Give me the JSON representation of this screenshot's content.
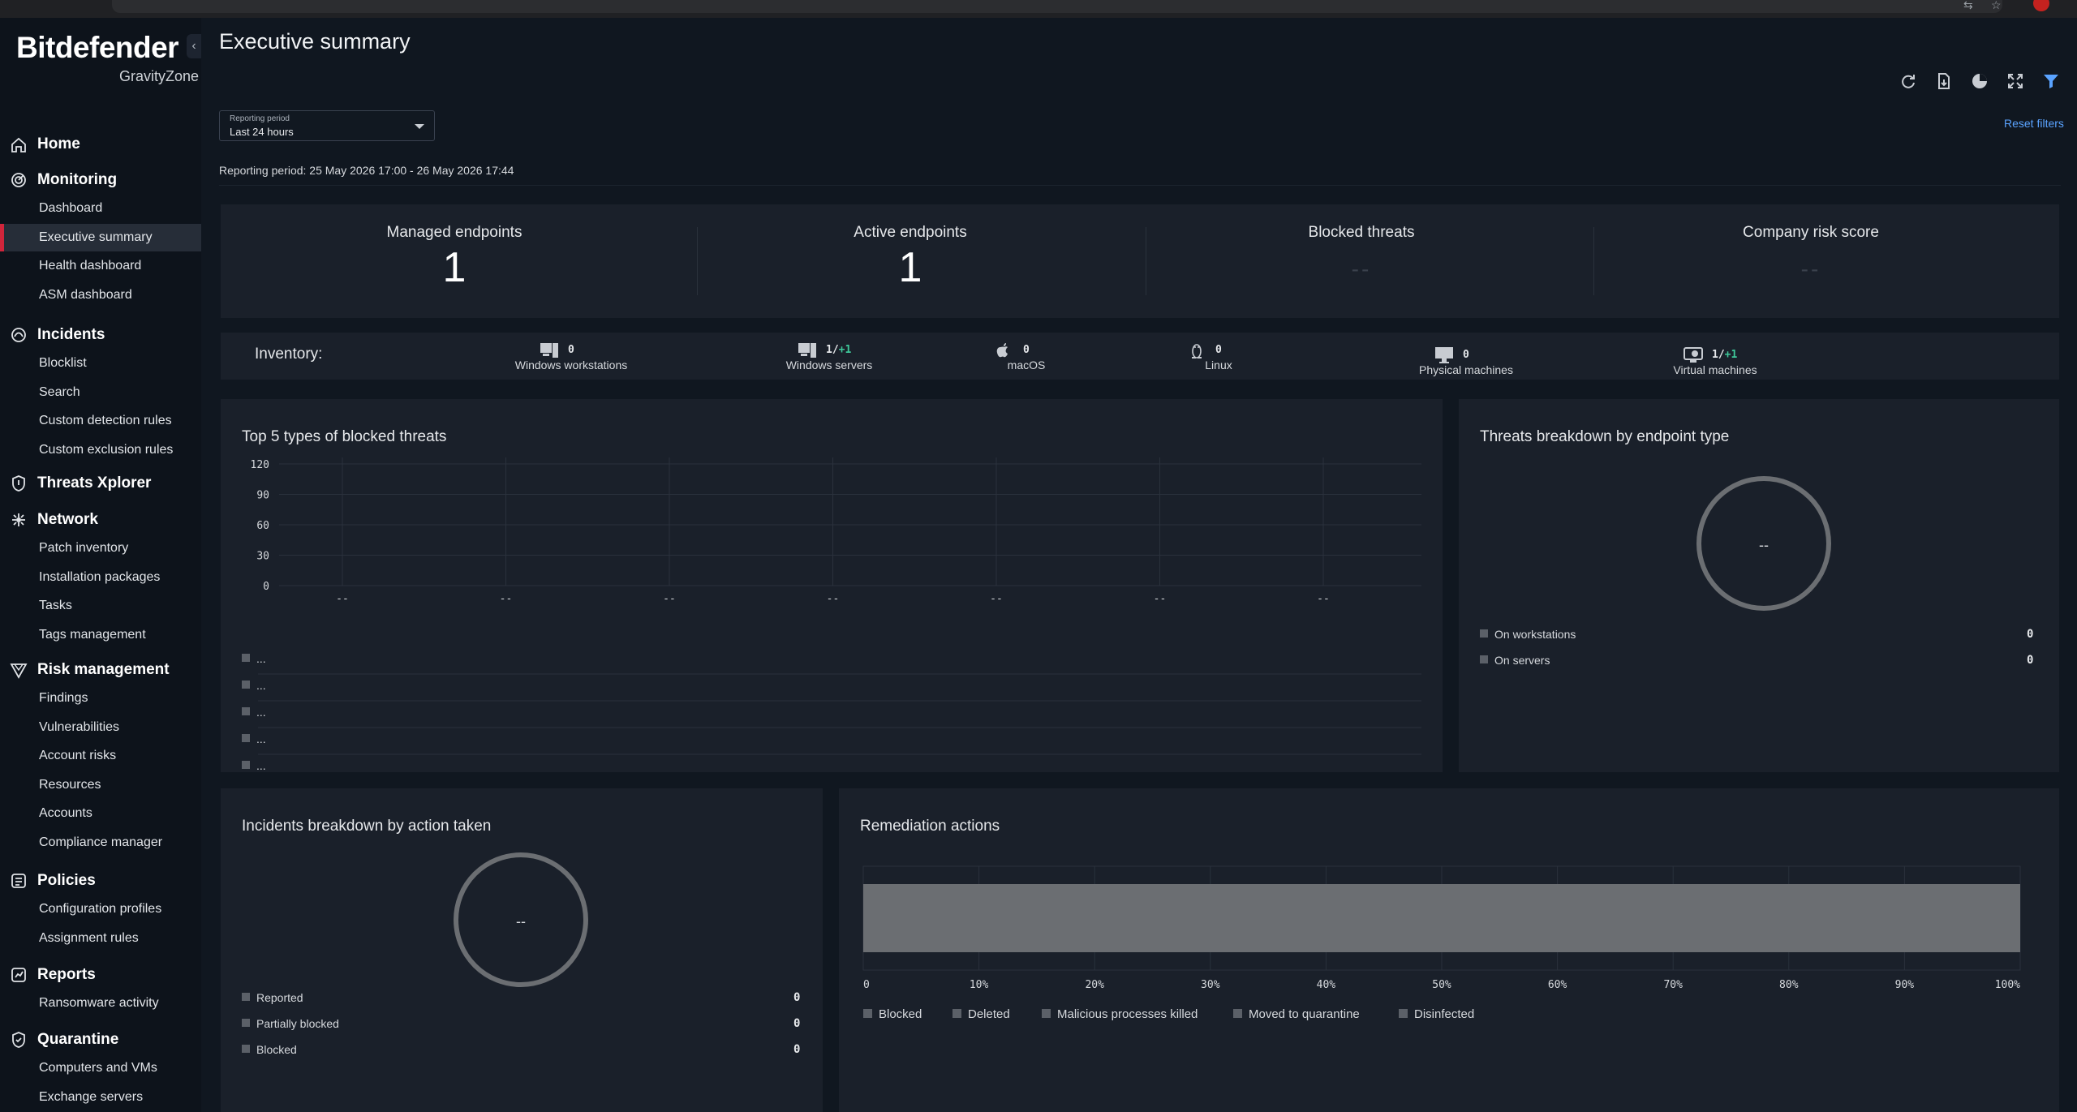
{
  "sidebar": {
    "brand": "Bitdefender",
    "product": "GravityZone",
    "sections": [
      {
        "label": "Home",
        "icon": "home-icon"
      },
      {
        "label": "Monitoring",
        "icon": "monitoring-icon",
        "items": [
          "Dashboard",
          "Executive summary",
          "Health dashboard",
          "ASM dashboard"
        ]
      },
      {
        "label": "Incidents",
        "icon": "incidents-icon",
        "items": [
          "Blocklist",
          "Search",
          "Custom detection rules",
          "Custom exclusion rules"
        ]
      },
      {
        "label": "Threats Xplorer",
        "icon": "shield-icon"
      },
      {
        "label": "Network",
        "icon": "network-icon",
        "items": [
          "Patch inventory",
          "Installation packages",
          "Tasks",
          "Tags management"
        ]
      },
      {
        "label": "Risk management",
        "icon": "risk-icon",
        "items": [
          "Findings",
          "Vulnerabilities",
          "Account risks",
          "Resources",
          "Accounts",
          "Compliance manager"
        ]
      },
      {
        "label": "Policies",
        "icon": "policies-icon",
        "items": [
          "Configuration profiles",
          "Assignment rules"
        ]
      },
      {
        "label": "Reports",
        "icon": "reports-icon",
        "items": [
          "Ransomware activity"
        ]
      },
      {
        "label": "Quarantine",
        "icon": "quarantine-icon",
        "items": [
          "Computers and VMs",
          "Exchange servers"
        ]
      }
    ],
    "active_item": "Executive summary"
  },
  "page": {
    "title": "Executive summary",
    "reset_filters": "Reset filters",
    "period_caption": "Reporting period",
    "period_value": "Last 24 hours",
    "period_text": "Reporting period: 25 May 2026 17:00 - 26 May 2026 17:44"
  },
  "kpis": [
    {
      "title": "Managed endpoints",
      "value": "1"
    },
    {
      "title": "Active endpoints",
      "value": "1"
    },
    {
      "title": "Blocked threats",
      "value": "--"
    },
    {
      "title": "Company risk score",
      "value": "--"
    }
  ],
  "inventory": {
    "label": "Inventory:",
    "items": [
      {
        "name": "Windows workstations",
        "count": "0",
        "delta": "",
        "icon": "windows-workstation-icon"
      },
      {
        "name": "Windows servers",
        "count": "1/",
        "delta": "+1",
        "icon": "windows-server-icon"
      },
      {
        "name": "macOS",
        "count": "0",
        "delta": "",
        "icon": "apple-icon"
      },
      {
        "name": "Linux",
        "count": "0",
        "delta": "",
        "icon": "linux-icon"
      },
      {
        "name": "Physical machines",
        "count": "0",
        "delta": "",
        "icon": "monitor-icon"
      },
      {
        "name": "Virtual machines",
        "count": "1/",
        "delta": "+1",
        "icon": "virtual-machine-icon"
      }
    ]
  },
  "top5": {
    "title": "Top 5 types of blocked threats",
    "legend": [
      "...",
      "...",
      "...",
      "...",
      "..."
    ]
  },
  "threats_breakdown": {
    "title": "Threats breakdown by endpoint type",
    "center": "--",
    "rows": [
      {
        "label": "On workstations",
        "value": "0"
      },
      {
        "label": "On servers",
        "value": "0"
      }
    ]
  },
  "incidents_breakdown": {
    "title": "Incidents breakdown by action taken",
    "center": "--",
    "rows": [
      {
        "label": "Reported",
        "value": "0"
      },
      {
        "label": "Partially blocked",
        "value": "0"
      },
      {
        "label": "Blocked",
        "value": "0"
      }
    ]
  },
  "remediation": {
    "title": "Remediation actions",
    "legend": [
      "Blocked",
      "Deleted",
      "Malicious processes killed",
      "Moved to quarantine",
      "Disinfected"
    ]
  },
  "chart_data": [
    {
      "type": "bar",
      "title": "Top 5 types of blocked threats",
      "categories": [
        "--",
        "--",
        "--",
        "--",
        "--",
        "--",
        "--"
      ],
      "values": [
        0,
        0,
        0,
        0,
        0,
        0,
        0
      ],
      "yticks": [
        "120",
        "90",
        "60",
        "30",
        "0"
      ],
      "ylim": [
        0,
        120
      ],
      "grid": true
    },
    {
      "type": "bar",
      "title": "Remediation actions",
      "orientation": "horizontal-stacked-percent",
      "xticks": [
        "0",
        "10%",
        "20%",
        "30%",
        "40%",
        "50%",
        "60%",
        "70%",
        "80%",
        "90%",
        "100%"
      ],
      "xlim": [
        0,
        100
      ],
      "series": [
        {
          "name": "Blocked",
          "values": [
            0
          ]
        },
        {
          "name": "Deleted",
          "values": [
            0
          ]
        },
        {
          "name": "Malicious processes killed",
          "values": [
            0
          ]
        },
        {
          "name": "Moved to quarantine",
          "values": [
            0
          ]
        },
        {
          "name": "Disinfected",
          "values": [
            0
          ]
        }
      ],
      "empty_fill": 100,
      "grid": true
    }
  ],
  "colors": {
    "accent_red": "#d0253b",
    "link_blue": "#5aa3ff",
    "delta_green": "#3fc89a",
    "bar_fill": "#6b6e72"
  }
}
